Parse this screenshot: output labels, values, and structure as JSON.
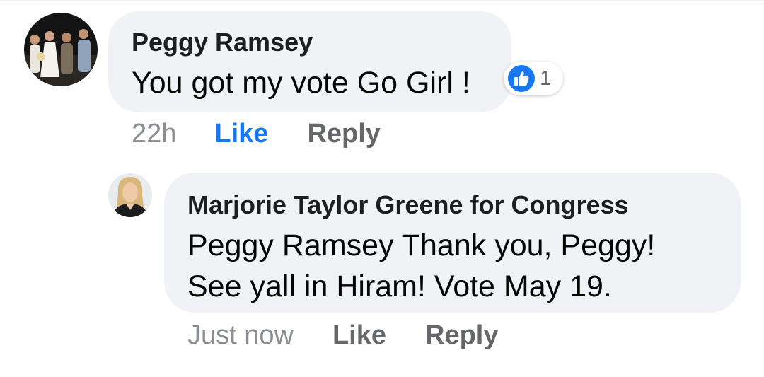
{
  "comments": [
    {
      "author": "Peggy Ramsey",
      "text": "You got my vote Go Girl !",
      "timestamp": "22h",
      "like_label": "Like",
      "reply_label": "Reply",
      "liked": true,
      "reaction": {
        "icon": "thumbs-up-icon",
        "count": "1"
      }
    },
    {
      "author": "Marjorie Taylor Greene for Congress",
      "text_lines": [
        "Peggy Ramsey Thank you, Peggy!",
        "See yall in Hiram! Vote May 19."
      ],
      "timestamp": "Just now",
      "like_label": "Like",
      "reply_label": "Reply",
      "liked": false
    }
  ],
  "colors": {
    "bubble": "#f0f2f5",
    "like_active": "#1877f2",
    "action_text": "#65676b",
    "timestamp": "#8a8d91"
  }
}
